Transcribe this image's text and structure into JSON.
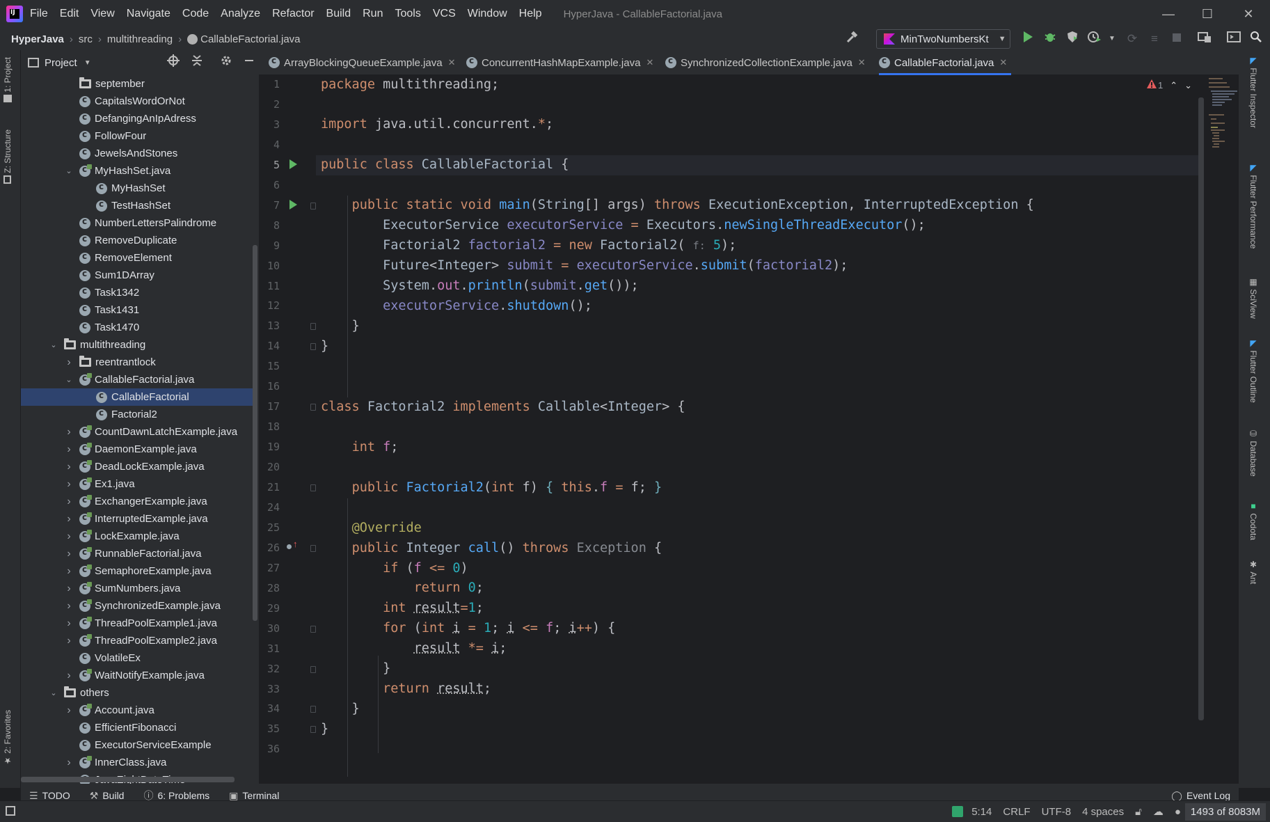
{
  "menubar": {
    "items": [
      "File",
      "Edit",
      "View",
      "Navigate",
      "Code",
      "Analyze",
      "Refactor",
      "Build",
      "Run",
      "Tools",
      "VCS",
      "Window",
      "Help"
    ],
    "window_title": "HyperJava - CallableFactorial.java",
    "minimize": "—",
    "maximize": "☐",
    "close": "✕"
  },
  "navbar": {
    "breadcrumbs": [
      "HyperJava",
      "src",
      "multithreading",
      "CallableFactorial.java"
    ],
    "run_config": "MinTwoNumbersKt"
  },
  "project_panel": {
    "title": "Project",
    "tree": [
      {
        "label": "september",
        "icon": "folder-icon",
        "level": 4,
        "chevron": ""
      },
      {
        "label": "CapitalsWordOrNot",
        "icon": "class-icon",
        "level": 4,
        "chevron": ""
      },
      {
        "label": "DefangingAnIpAdress",
        "icon": "class-icon",
        "level": 4,
        "chevron": ""
      },
      {
        "label": "FollowFour",
        "icon": "class-icon",
        "level": 4,
        "chevron": ""
      },
      {
        "label": "JewelsAndStones",
        "icon": "class-icon",
        "level": 4,
        "chevron": ""
      },
      {
        "label": "MyHashSet.java",
        "icon": "java-file-icon",
        "level": 4,
        "chevron": "expanded"
      },
      {
        "label": "MyHashSet",
        "icon": "class-icon",
        "level": 5,
        "chevron": ""
      },
      {
        "label": "TestHashSet",
        "icon": "class-icon",
        "level": 5,
        "chevron": ""
      },
      {
        "label": "NumberLettersPalindrome",
        "icon": "class-icon",
        "level": 4,
        "chevron": ""
      },
      {
        "label": "RemoveDuplicate",
        "icon": "class-icon",
        "level": 4,
        "chevron": ""
      },
      {
        "label": "RemoveElement",
        "icon": "class-icon",
        "level": 4,
        "chevron": ""
      },
      {
        "label": "Sum1DArray",
        "icon": "class-icon",
        "level": 4,
        "chevron": ""
      },
      {
        "label": "Task1342",
        "icon": "class-icon",
        "level": 4,
        "chevron": ""
      },
      {
        "label": "Task1431",
        "icon": "class-icon",
        "level": 4,
        "chevron": ""
      },
      {
        "label": "Task1470",
        "icon": "class-icon",
        "level": 4,
        "chevron": ""
      },
      {
        "label": "multithreading",
        "icon": "folder-icon",
        "level": 3,
        "chevron": "expanded"
      },
      {
        "label": "reentrantlock",
        "icon": "folder-icon",
        "level": 4,
        "chevron": "collapsed"
      },
      {
        "label": "CallableFactorial.java",
        "icon": "java-file-icon",
        "level": 4,
        "chevron": "expanded"
      },
      {
        "label": "CallableFactorial",
        "icon": "class-icon",
        "level": 5,
        "chevron": "",
        "selected": true
      },
      {
        "label": "Factorial2",
        "icon": "class-icon",
        "level": 5,
        "chevron": ""
      },
      {
        "label": "CountDawnLatchExample.java",
        "icon": "java-file-icon",
        "level": 4,
        "chevron": "collapsed"
      },
      {
        "label": "DaemonExample.java",
        "icon": "java-file-icon",
        "level": 4,
        "chevron": "collapsed"
      },
      {
        "label": "DeadLockExample.java",
        "icon": "java-file-icon",
        "level": 4,
        "chevron": "collapsed"
      },
      {
        "label": "Ex1.java",
        "icon": "java-file-icon",
        "level": 4,
        "chevron": "collapsed"
      },
      {
        "label": "ExchangerExample.java",
        "icon": "java-file-icon",
        "level": 4,
        "chevron": "collapsed"
      },
      {
        "label": "InterruptedExample.java",
        "icon": "java-file-icon",
        "level": 4,
        "chevron": "collapsed"
      },
      {
        "label": "LockExample.java",
        "icon": "java-file-icon",
        "level": 4,
        "chevron": "collapsed"
      },
      {
        "label": "RunnableFactorial.java",
        "icon": "java-file-icon",
        "level": 4,
        "chevron": "collapsed"
      },
      {
        "label": "SemaphoreExample.java",
        "icon": "java-file-icon",
        "level": 4,
        "chevron": "collapsed"
      },
      {
        "label": "SumNumbers.java",
        "icon": "java-file-icon",
        "level": 4,
        "chevron": "collapsed"
      },
      {
        "label": "SynchronizedExample.java",
        "icon": "java-file-icon",
        "level": 4,
        "chevron": "collapsed"
      },
      {
        "label": "ThreadPoolExample1.java",
        "icon": "java-file-icon",
        "level": 4,
        "chevron": "collapsed"
      },
      {
        "label": "ThreadPoolExample2.java",
        "icon": "java-file-icon",
        "level": 4,
        "chevron": "collapsed"
      },
      {
        "label": "VolatileEx",
        "icon": "class-icon",
        "level": 4,
        "chevron": ""
      },
      {
        "label": "WaitNotifyExample.java",
        "icon": "java-file-icon",
        "level": 4,
        "chevron": "collapsed"
      },
      {
        "label": "others",
        "icon": "folder-icon",
        "level": 3,
        "chevron": "expanded"
      },
      {
        "label": "Account.java",
        "icon": "java-file-icon",
        "level": 4,
        "chevron": "collapsed"
      },
      {
        "label": "EfficientFibonacci",
        "icon": "class-icon",
        "level": 4,
        "chevron": ""
      },
      {
        "label": "ExecutorServiceExample",
        "icon": "class-icon",
        "level": 4,
        "chevron": ""
      },
      {
        "label": "InnerClass.java",
        "icon": "java-file-icon",
        "level": 4,
        "chevron": "collapsed"
      },
      {
        "label": "JavaEightDateTime",
        "icon": "class-icon",
        "level": 4,
        "chevron": ""
      }
    ]
  },
  "left_stripe": {
    "project": "1: Project",
    "structure": "Z: Structure",
    "favorites": "2: Favorites"
  },
  "editor": {
    "tabs": [
      {
        "label": "ArrayBlockingQueueExample.java",
        "active": false
      },
      {
        "label": "ConcurrentHashMapExample.java",
        "active": false
      },
      {
        "label": "SynchronizedCollectionExample.java",
        "active": false
      },
      {
        "label": "CallableFactorial.java",
        "active": true
      }
    ],
    "tab_close": "✕",
    "warning_count": "1",
    "line_numbers": [
      "1",
      "2",
      "3",
      "4",
      "5",
      "6",
      "7",
      "8",
      "9",
      "10",
      "11",
      "12",
      "13",
      "14",
      "15",
      "16",
      "17",
      "18",
      "19",
      "20",
      "21",
      "24",
      "25",
      "26",
      "27",
      "28",
      "29",
      "30",
      "31",
      "32",
      "33",
      "34",
      "35",
      "36"
    ],
    "code_lines": [
      "package multithreading;",
      "",
      "import java.util.concurrent.*;",
      "",
      "public class CallableFactorial {",
      "",
      "    public static void main(String[] args) throws ExecutionException, InterruptedException {",
      "        ExecutorService executorService = Executors.newSingleThreadExecutor();",
      "        Factorial2 factorial2 = new Factorial2( f: 5);",
      "        Future<Integer> submit = executorService.submit(factorial2);",
      "        System.out.println(submit.get());",
      "        executorService.shutdown();",
      "    }",
      "}",
      "",
      "",
      "class Factorial2 implements Callable<Integer> {",
      "",
      "    int f;",
      "",
      "    public Factorial2(int f) { this.f = f; }",
      "",
      "    @Override",
      "    public Integer call() throws Exception {",
      "        if (f <= 0)",
      "            return 0;",
      "        int result=1;",
      "        for (int i = 1; i <= f; i++) {",
      "            result *= i;",
      "        }",
      "        return result;",
      "    }",
      "}",
      ""
    ]
  },
  "right_stripe": [
    "Flutter Inspector",
    "Flutter Performance",
    "SciView",
    "Flutter Outline",
    "Database",
    "Codota",
    "Ant"
  ],
  "bottom_tools": [
    {
      "label": "TODO",
      "icon": "list-icon"
    },
    {
      "label": "Build",
      "icon": "hammer-icon"
    },
    {
      "label": "6: Problems",
      "icon": "info-icon"
    },
    {
      "label": "Terminal",
      "icon": "terminal-icon"
    }
  ],
  "event_log": "Event Log",
  "statusbar": {
    "position": "5:14",
    "line_sep": "CRLF",
    "encoding": "UTF-8",
    "indent": "4 spaces",
    "memory": "1493 of 8083M"
  },
  "colors": {
    "background": "#1e1f22",
    "panel": "#2b2d30",
    "selection": "#2e436e",
    "accent": "#3574f0",
    "keyword": "#cf8e6d",
    "function": "#56a8f5",
    "field": "#c77dbb",
    "number": "#2aacb8",
    "run_green": "#5fb865"
  }
}
